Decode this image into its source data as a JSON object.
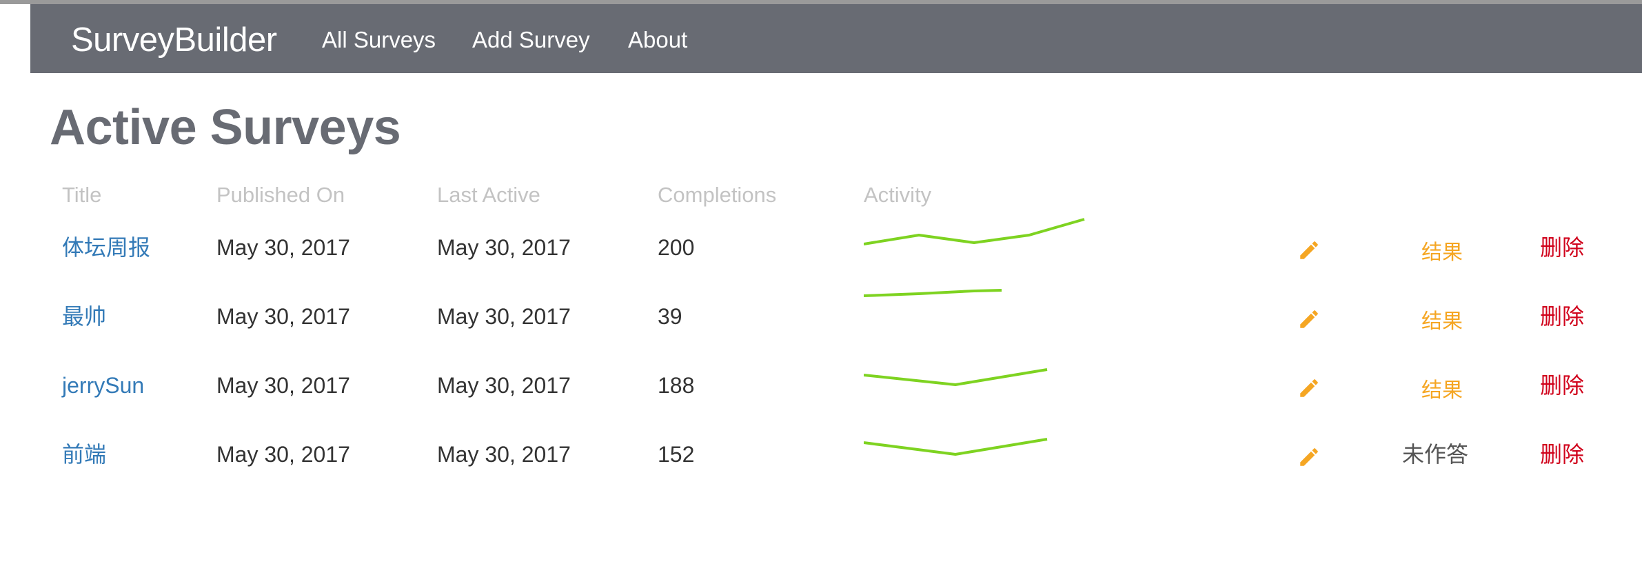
{
  "navbar": {
    "brand": "SurveyBuilder",
    "links": [
      {
        "label": "All Surveys"
      },
      {
        "label": "Add Survey"
      },
      {
        "label": "About"
      }
    ]
  },
  "page_title": "Active Surveys",
  "table": {
    "headers": [
      "Title",
      "Published On",
      "Last Active",
      "Completions",
      "Activity"
    ],
    "rows": [
      {
        "title": "体坛周报",
        "published": "May 30, 2017",
        "last_active": "May 30, 2017",
        "completions": "200",
        "results_label": "结果",
        "delete_label": "删除"
      },
      {
        "title": "最帅",
        "published": "May 30, 2017",
        "last_active": "May 30, 2017",
        "completions": "39",
        "results_label": "结果",
        "delete_label": "删除"
      },
      {
        "title": "jerrySun",
        "published": "May 30, 2017",
        "last_active": "May 30, 2017",
        "completions": "188",
        "results_label": "结果",
        "delete_label": "删除"
      },
      {
        "title": "前端",
        "published": "May 30, 2017",
        "last_active": "May 30, 2017",
        "completions": "152",
        "results_label": "未作答",
        "delete_label": "删除"
      }
    ]
  },
  "colors": {
    "navbar_bg": "#686b73",
    "link": "#337ab7",
    "sparkline": "#7ed321",
    "edit_icon": "#f5a623",
    "results": "#f5a623",
    "delete": "#d0021b"
  },
  "icons": [
    "pencil-icon"
  ]
}
